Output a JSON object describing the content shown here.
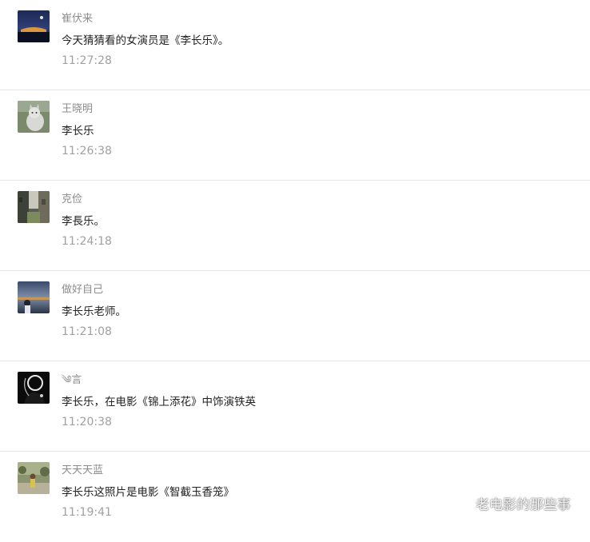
{
  "comments": [
    {
      "nickname": "崔伏来",
      "content": "今天猜猜看的女演员是《李长乐》。",
      "time": "11:27:28",
      "avatar_icon": "night-city-avatar-icon"
    },
    {
      "nickname": "王晓明",
      "content": "李长乐",
      "time": "11:26:38",
      "avatar_icon": "cat-avatar-icon"
    },
    {
      "nickname": "克俭",
      "content": "李長乐。",
      "time": "11:24:18",
      "avatar_icon": "street-avatar-icon"
    },
    {
      "nickname": "做好自己",
      "content": "李长乐老师。",
      "time": "11:21:08",
      "avatar_icon": "dusk-lake-avatar-icon"
    },
    {
      "nickname": "༄言",
      "content": "李长乐，在电影《锦上添花》中饰演铁英",
      "time": "11:20:38",
      "avatar_icon": "silhouette-avatar-icon"
    },
    {
      "nickname": "天天天蓝",
      "content": "李长乐这照片是电影《智截玉香笼》",
      "time": "11:19:41",
      "avatar_icon": "garden-avatar-icon"
    }
  ],
  "watermark": {
    "text": "老电影的那些事",
    "icon": "wechat-icon"
  }
}
